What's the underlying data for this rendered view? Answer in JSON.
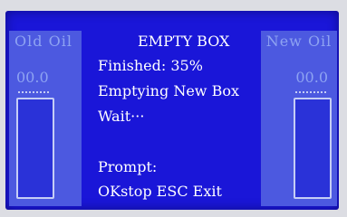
{
  "screen": {
    "title": "EMPTY BOX",
    "finished_label": "Finished: 35%",
    "status": "Emptying New Box",
    "wait": "Wait···",
    "prompt_label": "Prompt:",
    "prompt_actions": "OKstop ESC Exit"
  },
  "left_panel": {
    "label": "Old Oil",
    "value": "00.0"
  },
  "right_panel": {
    "label": "New Oil",
    "value": "00.0"
  },
  "colors": {
    "screen_background": "#1a16d8",
    "panel_background": "#4c59e0",
    "text": "#ffffff",
    "dim_text": "#8ea3f2"
  }
}
